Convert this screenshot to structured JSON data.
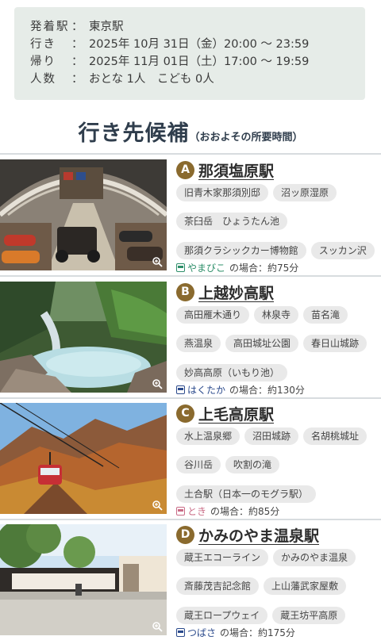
{
  "summary": {
    "departure_label": "発着駅",
    "departure_value": "東京駅",
    "outbound_label": "行き",
    "outbound_value": "2025年 10月 31日（金）20:00 〜 23:59",
    "return_label": "帰り",
    "return_value": "2025年 11月 01日（土）17:00 〜 19:59",
    "people_label": "人数",
    "people_value": "おとな 1人　こども 0人",
    "separator": "："
  },
  "heading": {
    "main": "行き先候補",
    "sub": "（おおよその所要時間）"
  },
  "destinations": [
    {
      "letter": "A",
      "station": "那須塩原駅",
      "tags": [
        "旧青木家那須別邸",
        "沼ッ原湿原",
        "茶臼岳　ひょうたん池",
        "那須クラシックカー博物館",
        "スッカン沢"
      ],
      "train": "やまびこ",
      "train_color": "#2e8f6a",
      "case_text": "の場合：約75分"
    },
    {
      "letter": "B",
      "station": "上越妙高駅",
      "tags": [
        "高田雁木通り",
        "林泉寺",
        "苗名滝",
        "燕温泉",
        "高田城址公園",
        "春日山城跡",
        "妙高高原（いもり池）"
      ],
      "train": "はくたか",
      "train_color": "#2b4a8c",
      "case_text": "の場合：約130分"
    },
    {
      "letter": "C",
      "station": "上毛高原駅",
      "tags": [
        "水上温泉郷",
        "沼田城跡",
        "名胡桃城址",
        "谷川岳",
        "吹割の滝",
        "土合駅（日本一のモグラ駅）"
      ],
      "train": "とき",
      "train_color": "#c96b86",
      "case_text": "の場合：約85分"
    },
    {
      "letter": "D",
      "station": "かみのやま温泉駅",
      "tags": [
        "蔵王エコーライン",
        "かみのやま温泉",
        "斎藤茂吉記念館",
        "上山藩武家屋敷",
        "蔵王ロープウェイ",
        "蔵王坊平高原"
      ],
      "train": "つばさ",
      "train_color": "#2b4a8c",
      "case_text": "の場合：約175分"
    }
  ],
  "icons": {
    "train_icon": "train-icon",
    "zoom_icon": "zoom-in-icon"
  }
}
